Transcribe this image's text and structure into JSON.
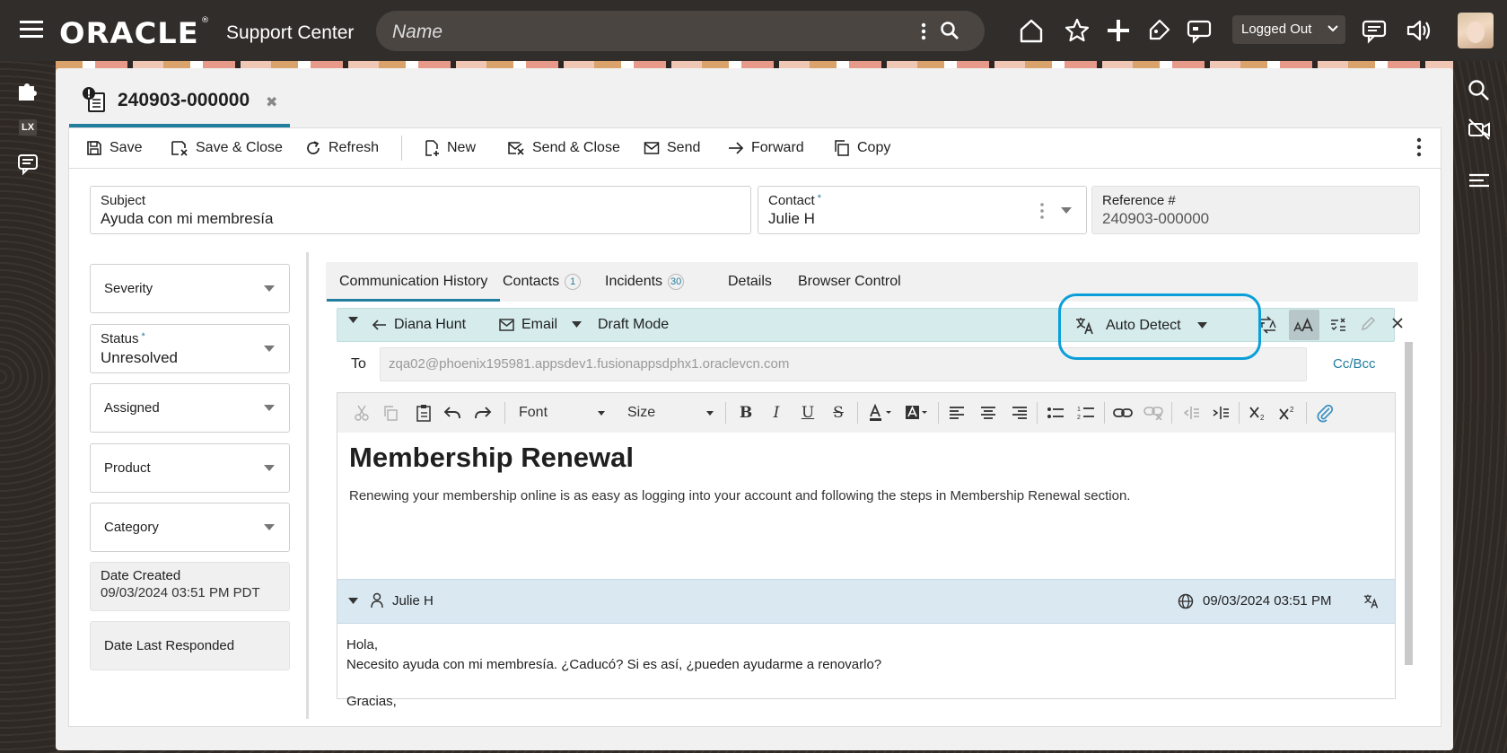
{
  "header": {
    "logo_text": "ORACLE",
    "app_title": "Support Center",
    "search_placeholder": "Name",
    "status_select": "Logged Out"
  },
  "left_rail": {
    "lx_label": "LX"
  },
  "record_tab": {
    "title": "240903-000000"
  },
  "toolbar": {
    "save": "Save",
    "save_close": "Save & Close",
    "refresh": "Refresh",
    "new": "New",
    "send_close": "Send & Close",
    "send": "Send",
    "forward": "Forward",
    "copy": "Copy"
  },
  "fields": {
    "subject_label": "Subject",
    "subject_value": "Ayuda con mi membresía",
    "contact_label": "Contact",
    "contact_value": "Julie H",
    "reference_label": "Reference #",
    "reference_value": "240903-000000",
    "required_mark": "*"
  },
  "side_fields": {
    "severity": "Severity",
    "status_label": "Status",
    "status_value": "Unresolved",
    "assigned": "Assigned",
    "product": "Product",
    "category": "Category",
    "date_created_label": "Date Created",
    "date_created_value": "09/03/2024 03:51 PM PDT",
    "date_last_responded_label": "Date Last Responded"
  },
  "tabs": {
    "communication_history": "Communication History",
    "contacts": "Contacts",
    "contacts_count": "1",
    "incidents": "Incidents",
    "incidents_count": "30",
    "details": "Details",
    "browser_control": "Browser Control"
  },
  "draft": {
    "author": "Diana Hunt",
    "channel": "Email",
    "mode": "Draft Mode",
    "language": "Auto Detect",
    "to_label": "To",
    "to_value": "zqa02@phoenix195981.appsdev1.fusionappsdphx1.oraclevcn.com",
    "cc_bcc": "Cc/Bcc"
  },
  "editor": {
    "font_select": "Font",
    "size_select": "Size",
    "heading": "Membership Renewal",
    "body": "Renewing your membership online is as easy as logging into your account and following the steps in Membership Renewal section."
  },
  "message": {
    "author": "Julie H",
    "timestamp": "09/03/2024 03:51 PM",
    "line1": "Hola,",
    "line2": "Necesito ayuda con mi membresía. ¿Caducó? Si es así, ¿pueden ayudarme a renovarlo?",
    "line3": "Gracias,"
  },
  "colors": {
    "accent": "#227e9e",
    "highlight": "#0a9fd9",
    "header_bg": "#312d2a",
    "draft_bg": "#d5ebec",
    "message_bg": "#dae8f2"
  }
}
